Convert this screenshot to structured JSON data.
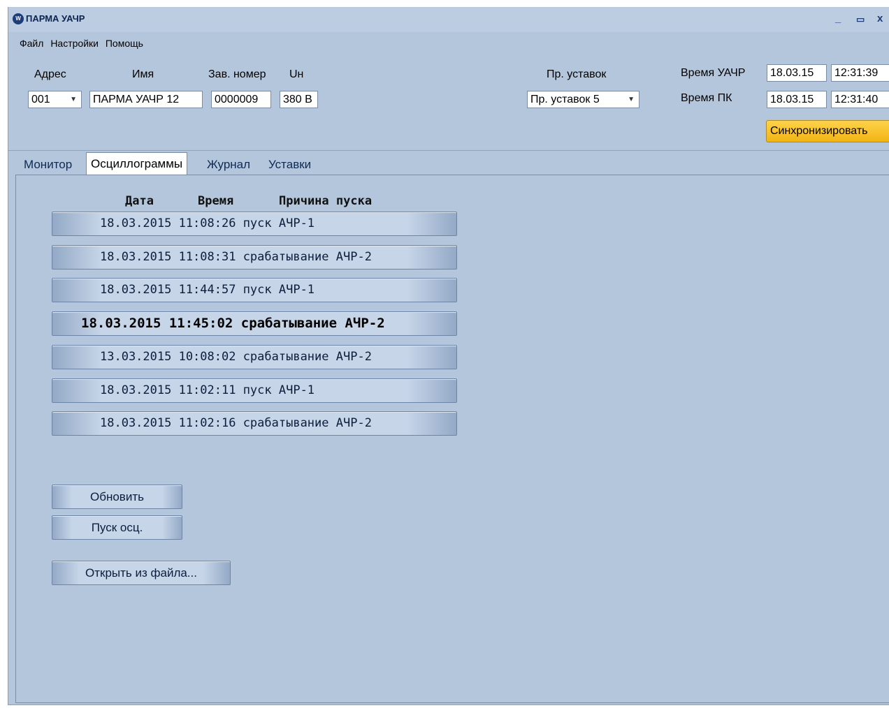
{
  "app": {
    "title": "ПАРМА УАЧР",
    "icon": "app-logo-icon",
    "minimize": "_",
    "maximize": "▭",
    "close": "x"
  },
  "menu": [
    "Файл",
    "Настройки",
    "Помощь"
  ],
  "header": {
    "address_label": "Адрес",
    "name_label": "Имя",
    "serial_label": "Зав. номер",
    "un_label": "Uн",
    "address_value": "001",
    "name_value": "ПАРМА УАЧР 12",
    "serial_value": "0000009",
    "un_value": "380 В",
    "settings_label": "Пр. уставок",
    "settings_value": "Пр. уставок 5",
    "device_time_label": "Время УАЧР",
    "device_date": "18.03.15",
    "device_time": "12:31:39",
    "pc_time_label": "Время ПК",
    "pc_date": "18.03.15",
    "pc_time": "12:31:40",
    "sync_button": "Синхронизировать"
  },
  "tabs": [
    "Монитор",
    "Осциллограммы",
    "Журнал",
    "Уставки"
  ],
  "active_tab": "Осциллограммы",
  "oscillograms": {
    "columns": [
      "Дата",
      "Время",
      "Причина пуска"
    ],
    "rows": [
      "18.03.2015 11:08:26 пуск АЧР-1",
      "18.03.2015 11:08:31 срабатывание АЧР-2",
      "18.03.2015 11:44:57 пуск АЧР-1",
      "18.03.2015 11:45:02 срабатывание АЧР-2",
      "13.03.2015 10:08:02 срабатывание АЧР-2",
      "18.03.2015 11:02:11 пуск АЧР-1",
      "18.03.2015 11:02:16 срабатывание АЧР-2"
    ],
    "selected_row": 4
  },
  "actions": {
    "refresh": "Обновить",
    "start_osc": "Пуск осц.",
    "open_file": "Открыть из файла..."
  },
  "colors": {
    "window_bg": "#b4c6dc",
    "accent_button": "#f1b514",
    "text_dark": "#0c1e3c"
  }
}
